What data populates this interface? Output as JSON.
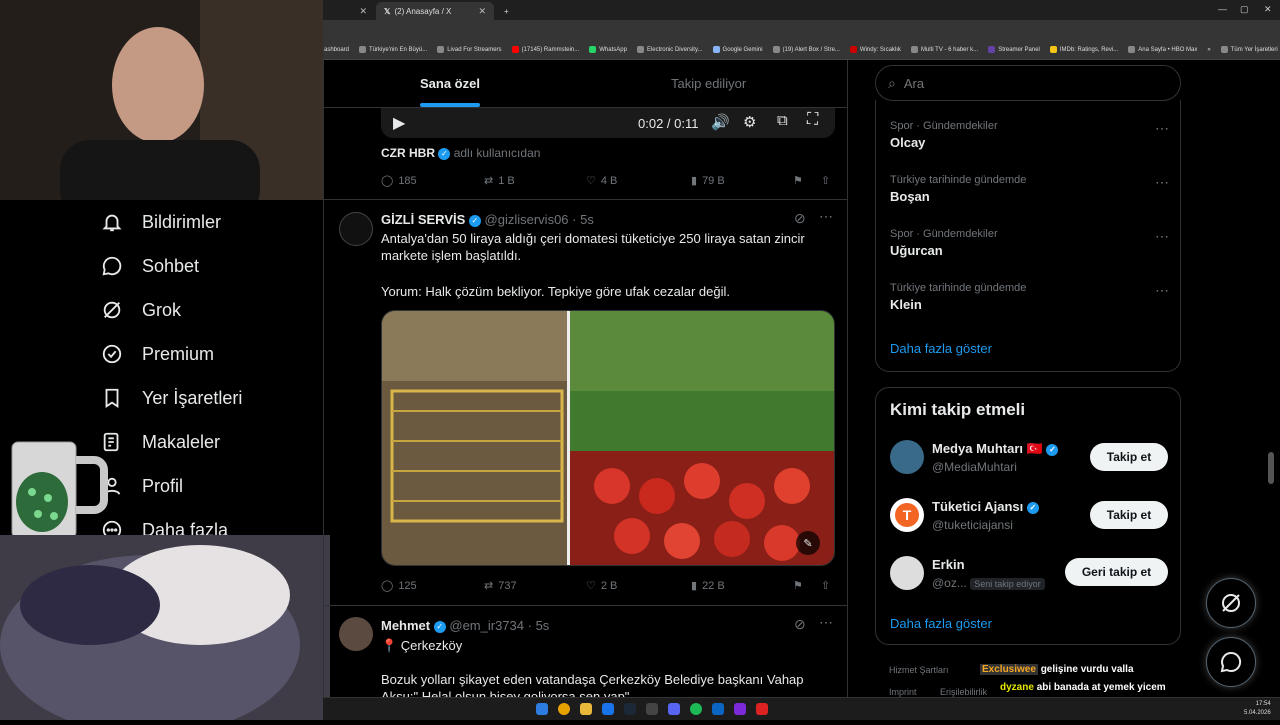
{
  "browser": {
    "tab_prev_label": "",
    "tab_active_label": "(2) Anasayfa / X",
    "new_tab": "+",
    "bookmarks": [
      "ashboard",
      "Türkiye'nin En Büyü...",
      "Livad For Streamers",
      "(17145) Rammstein...",
      "WhatsApp",
      "Electronic Diversity...",
      "Google Gemini",
      "(19) Alert Box / Stre...",
      "Windy: Sıcaklık",
      "Multi TV - 6 haber k...",
      "Streamer Panel",
      "IMDb: Ratings, Revi...",
      "Ana Sayfa • HBO Max",
      "»",
      "Tüm Yer İşaretleri"
    ]
  },
  "nav": {
    "items": [
      {
        "label": "Bildirimler",
        "icon": "bell-icon"
      },
      {
        "label": "Sohbet",
        "icon": "chat-bubble-icon"
      },
      {
        "label": "Grok",
        "icon": "grok-icon"
      },
      {
        "label": "Premium",
        "icon": "premium-badge-icon"
      },
      {
        "label": "Yer İşaretleri",
        "icon": "bookmark-icon"
      },
      {
        "label": "Makaleler",
        "icon": "article-icon"
      },
      {
        "label": "Profil",
        "icon": "profile-icon"
      },
      {
        "label": "Daha fazla",
        "icon": "more-circle-icon"
      }
    ]
  },
  "feed": {
    "tabs": [
      "Sana özel",
      "Takip ediliyor"
    ],
    "video": {
      "time": "0:02 / 0:11"
    },
    "tweet1": {
      "source_name": "CZR HBR",
      "source_suffix": "adlı kullanıcıdan",
      "replies": "185",
      "reposts": "1 B",
      "likes": "4 B",
      "views": "79 B"
    },
    "tweet2": {
      "name": "GİZLİ SERVİS",
      "handle": "@gizliservis06",
      "time": "· 5s",
      "text1": "Antalya'dan 50 liraya aldığı çeri domatesi tüketiciye 250 liraya satan zincir marketе işlem başlatıldı.",
      "text2": "Yorum: Halk çözüm bekliyor. Tepkiye göre ufak cezalar değil.",
      "replies": "125",
      "reposts": "737",
      "likes": "2 B",
      "views": "22 B"
    },
    "tweet3": {
      "name": "Mehmet",
      "handle": "@em_ir3734",
      "time": "· 5s",
      "location": "📍 Çerkezköy",
      "text": "Bozuk yolları şikayet eden vatandaşa Çerkezköy Belediye başkanı Vahap Aksu:\" Helal olsun bisey goliyorsa sen yap\""
    }
  },
  "right": {
    "search_placeholder": "Ara",
    "trends": [
      {
        "meta": "Spor · Gündemdekiler",
        "name": "Olcay"
      },
      {
        "meta": "Türkiye tarihinde gündemde",
        "name": "Boşan"
      },
      {
        "meta": "Spor · Gündemdekiler",
        "name": "Uğurcan"
      },
      {
        "meta": "Türkiye tarihinde gündemde",
        "name": "Klein"
      }
    ],
    "show_more": "Daha fazla göster",
    "who_to_follow_title": "Kimi takip etmeli",
    "suggestions": [
      {
        "name": "Medya Muhtarı",
        "flag": "🇹🇷",
        "handle": "@MediaMuhtari",
        "button": "Takip et"
      },
      {
        "name": "Tüketici Ajansı",
        "handle": "@tuketiciajansi",
        "button": "Takip et"
      },
      {
        "name": "Erkin",
        "handle": "@oz...",
        "follows_you": "Seni takip ediyor",
        "button": "Geri takip et"
      }
    ],
    "show_more2": "Daha fazla göster",
    "footer1": "Hizmet Şartları",
    "footer2": "Imprint",
    "footer3": "Erişilebilirlik"
  },
  "chat_overlay": [
    {
      "user": "Exclusiwee",
      "msg": "gelişine vurdu valla",
      "color": "#f5a623"
    },
    {
      "user": "dyzane",
      "msg": "abi banada at yemek yicem",
      "color": "#e6e600"
    },
    {
      "user": "dyzane",
      "msg": "",
      "color": "#e6e600"
    }
  ],
  "taskbar": {
    "time": "17:54",
    "date": "5.04.2026"
  },
  "colors": {
    "accent": "#1d9bf0",
    "bg": "#000000",
    "border": "#2f3336"
  }
}
